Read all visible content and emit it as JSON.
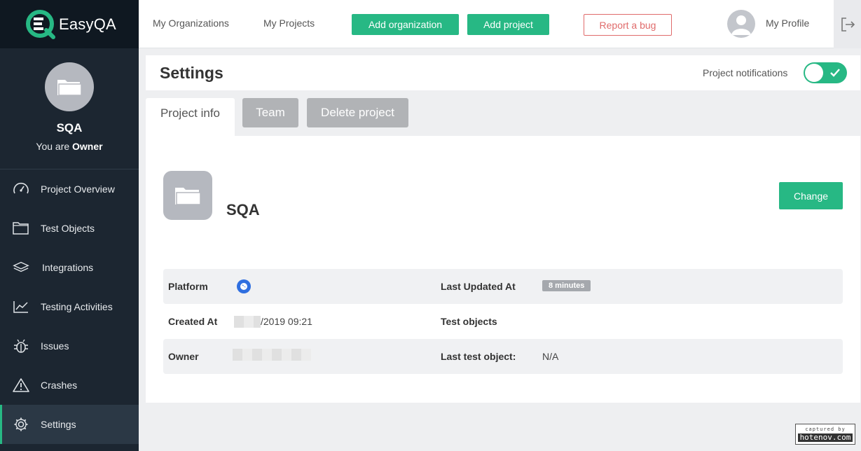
{
  "app": {
    "name": "EasyQA"
  },
  "sidebar": {
    "project_name": "SQA",
    "role_prefix": "You are",
    "role": "Owner",
    "items": [
      {
        "label": "Project Overview",
        "icon": "speedometer-icon"
      },
      {
        "label": "Test Objects",
        "icon": "folder-icon"
      },
      {
        "label": "Integrations",
        "icon": "layers-icon"
      },
      {
        "label": "Testing Activities",
        "icon": "chart-line-icon"
      },
      {
        "label": "Issues",
        "icon": "bug-icon"
      },
      {
        "label": "Crashes",
        "icon": "warning-icon"
      },
      {
        "label": "Settings",
        "icon": "gear-icon",
        "active": true
      }
    ]
  },
  "topbar": {
    "my_organizations": "My Organizations",
    "my_projects": "My Projects",
    "add_organization": "Add organization",
    "add_project": "Add project",
    "report_bug": "Report a bug",
    "my_profile": "My Profile"
  },
  "settings": {
    "title": "Settings",
    "notifications_label": "Project notifications",
    "notifications_on": true
  },
  "tabs": {
    "project_info": "Project info",
    "team": "Team",
    "delete_project": "Delete project"
  },
  "project": {
    "name": "SQA",
    "change_label": "Change",
    "platform_label": "Platform",
    "platform_icon": "web-globe-icon",
    "last_updated_label": "Last Updated At",
    "last_updated_value": "8 minutes",
    "created_label": "Created At",
    "created_value": "/2019 09:21",
    "test_objects_label": "Test objects",
    "owner_label": "Owner",
    "last_test_object_label": "Last test object:",
    "last_test_object_value": "N/A"
  },
  "watermark": {
    "top": "captured by",
    "bottom": "hotenov.com"
  },
  "colors": {
    "accent": "#27b884",
    "sidebar": "#1c2631",
    "danger": "#e06b6b"
  }
}
